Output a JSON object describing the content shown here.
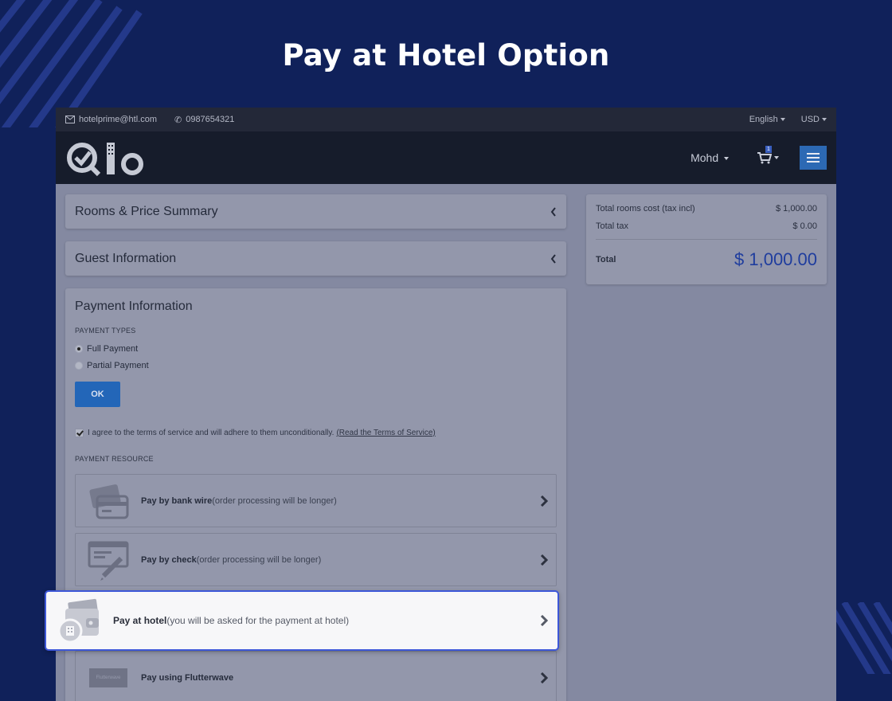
{
  "promo": {
    "title": "Pay at Hotel Option"
  },
  "topbar": {
    "email": "hotelprime@htl.com",
    "phone": "0987654321",
    "language": "English",
    "currency": "USD"
  },
  "navbar": {
    "user": "Mohd",
    "cart_count": "1"
  },
  "accordions": {
    "rooms": "Rooms & Price Summary",
    "guest": "Guest Information"
  },
  "payment": {
    "title": "Payment Information",
    "types_label": "PAYMENT TYPES",
    "options": [
      {
        "label": "Full Payment",
        "selected": true
      },
      {
        "label": "Partial Payment",
        "selected": false
      }
    ],
    "ok_label": "OK",
    "terms_text": "I agree to the terms of service and will adhere to them unconditionally.",
    "terms_link": "(Read the Terms of Service)",
    "terms_checked": true,
    "resource_label": "PAYMENT RESOURCE",
    "methods": [
      {
        "strong": "Pay by bank wire",
        "note": " (order processing will be longer)",
        "icon": "bank-card-icon"
      },
      {
        "strong": "Pay by check",
        "note": " (order processing will be longer)",
        "icon": "check-pen-icon"
      },
      {
        "strong": "Pay at hotel",
        "note": " (you will be asked for the payment at hotel)",
        "icon": "wallet-hotel-icon"
      },
      {
        "strong": "Pay using Flutterwave",
        "note": "",
        "icon": "flutterwave-logo",
        "logo_text": "Flutterwave"
      }
    ]
  },
  "summary": {
    "rooms_label": "Total rooms cost (tax incl)",
    "rooms_value": "$ 1,000.00",
    "tax_label": "Total tax",
    "tax_value": "$ 0.00",
    "total_label": "Total",
    "total_value": "$ 1,000.00"
  },
  "colors": {
    "background": "#10215a",
    "highlight_border": "#3d57d8",
    "total_value": "#1f3d9e",
    "ok_button": "#2366b8"
  }
}
